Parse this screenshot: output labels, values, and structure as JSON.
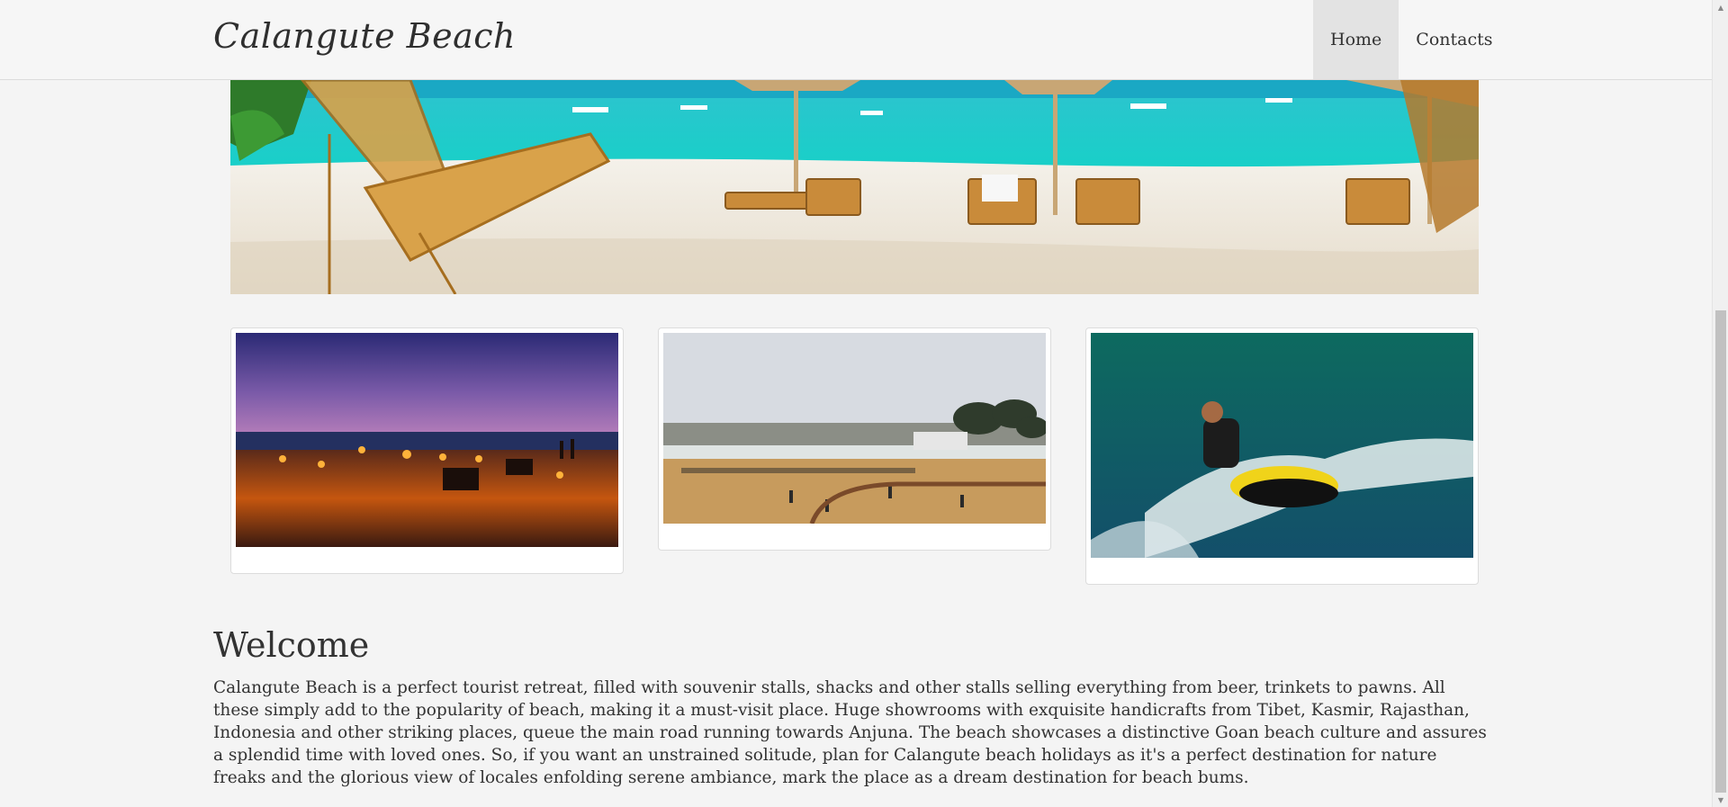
{
  "navbar": {
    "brand": "Calangute Beach",
    "items": [
      {
        "label": "Home",
        "active": true
      },
      {
        "label": "Contacts",
        "active": false
      }
    ]
  },
  "hero": {
    "image": "beach-chairs-turquoise-sea-photo"
  },
  "gallery": [
    {
      "image": "night-beach-torches-photo"
    },
    {
      "image": "crowded-beach-shore-photo"
    },
    {
      "image": "jet-ski-rider-photo"
    }
  ],
  "welcome": {
    "title": "Welcome",
    "text": "Calangute Beach is a perfect tourist retreat, filled with souvenir stalls, shacks and other stalls selling everything from beer, trinkets to pawns. All these simply add to the popularity of beach, making it a must-visit place. Huge showrooms with exquisite handicrafts from Tibet, Kasmir, Rajasthan, Indonesia and other striking places, queue the main road running towards Anjuna. The beach showcases a distinctive Goan beach culture and assures a splendid time with loved ones. So, if you want an unstrained solitude, plan for Calangute beach holidays as it's a perfect destination for nature freaks and the glorious view of locales enfolding serene ambiance, mark the place as a dream destination for beach bums."
  },
  "colors": {
    "background": "#f4f4f4",
    "navbar": "#f6f6f6",
    "nav_active": "#e3e3e3",
    "text": "#333333"
  },
  "scrollbar": {
    "icons": [
      "scroll-up-arrow-icon",
      "scroll-down-arrow-icon"
    ]
  }
}
